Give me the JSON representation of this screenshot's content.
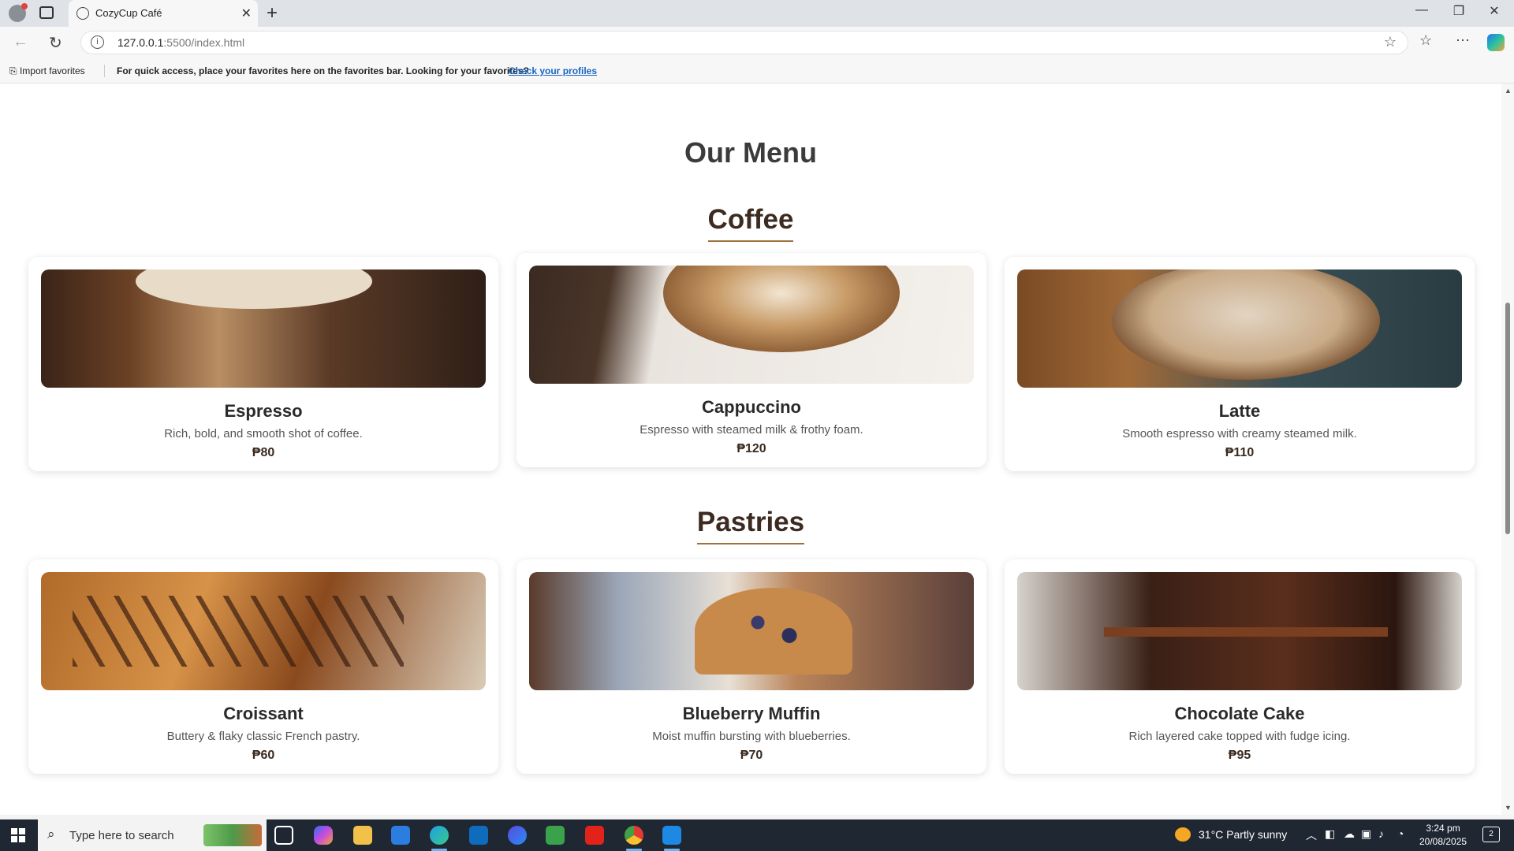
{
  "browser": {
    "tab_title": "CozyCup Café",
    "address_host": "127.0.0.1",
    "address_path": ":5500/index.html"
  },
  "favorites_bar": {
    "import_label": "Import favorites",
    "message": "For quick access, place your favorites here on the favorites bar. Looking for your favorites?",
    "link_label": "Check your profiles"
  },
  "page": {
    "title": "Our Menu",
    "sections": [
      {
        "title": "Coffee",
        "items": [
          {
            "name": "Espresso",
            "description": "Rich, bold, and smooth shot of coffee.",
            "price": "₱80"
          },
          {
            "name": "Cappuccino",
            "description": "Espresso with steamed milk & frothy foam.",
            "price": "₱120"
          },
          {
            "name": "Latte",
            "description": "Smooth espresso with creamy steamed milk.",
            "price": "₱110"
          }
        ]
      },
      {
        "title": "Pastries",
        "items": [
          {
            "name": "Croissant",
            "description": "Buttery & flaky classic French pastry.",
            "price": "₱60"
          },
          {
            "name": "Blueberry Muffin",
            "description": "Moist muffin bursting with blueberries.",
            "price": "₱70"
          },
          {
            "name": "Chocolate Cake",
            "description": "Rich layered cake topped with fudge icing.",
            "price": "₱95"
          }
        ]
      }
    ]
  },
  "taskbar": {
    "search_placeholder": "Type here to search",
    "weather": "31°C  Partly sunny",
    "time": "3:24 pm",
    "date": "20/08/2025",
    "notification_count": "2"
  }
}
